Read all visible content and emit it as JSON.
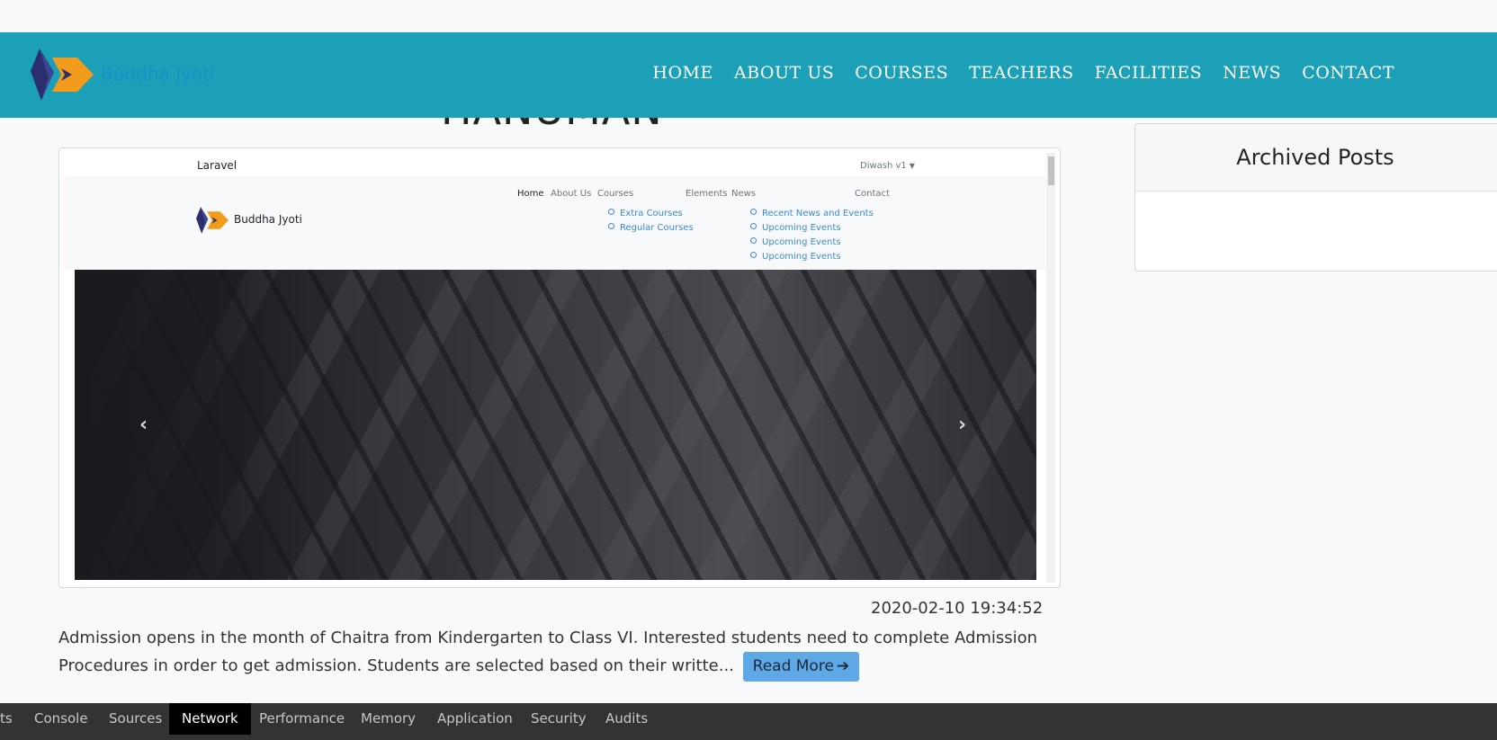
{
  "header": {
    "brand": "Buddha Jyoti",
    "nav": [
      "HOME",
      "ABOUT US",
      "COURSES",
      "TEACHERS",
      "FACILITIES",
      "NEWS",
      "CONTACT"
    ]
  },
  "page": {
    "heading": "HANUMAN"
  },
  "post": {
    "embedded": {
      "brand": "Laravel",
      "user": "Diwash v1",
      "logo_text": "Buddha Jyoti",
      "nav": {
        "home": "Home",
        "about": "About Us",
        "courses": "Courses",
        "elements": "Elements",
        "news": "News",
        "contact": "Contact"
      },
      "courses_sub": [
        "Extra Courses",
        "Regular Courses"
      ],
      "news_sub": [
        "Recent News and Events",
        "Upcoming Events",
        "Upcoming Events",
        "Upcoming Events"
      ],
      "carousel_prev": "‹",
      "carousel_next": "›"
    },
    "timestamp": "2020-02-10 19:34:52",
    "excerpt": "Admission opens in the month of Chaitra from Kindergarten to Class VI. Interested students need to complete Admission Procedures in order to get admission. Students are selected based on their writte...",
    "read_more": "Read More",
    "read_more_arrow": "➔"
  },
  "sidebar": {
    "title": "Archived Posts"
  },
  "devtools": {
    "tabs": [
      "ts",
      "Console",
      "Sources",
      "Network",
      "Performance",
      "Memory",
      "Application",
      "Security",
      "Audits"
    ],
    "active": "Network"
  },
  "colors": {
    "navbar": "#1ba0b7",
    "read_more": "#5ea8e6",
    "devtools": "#333333"
  }
}
